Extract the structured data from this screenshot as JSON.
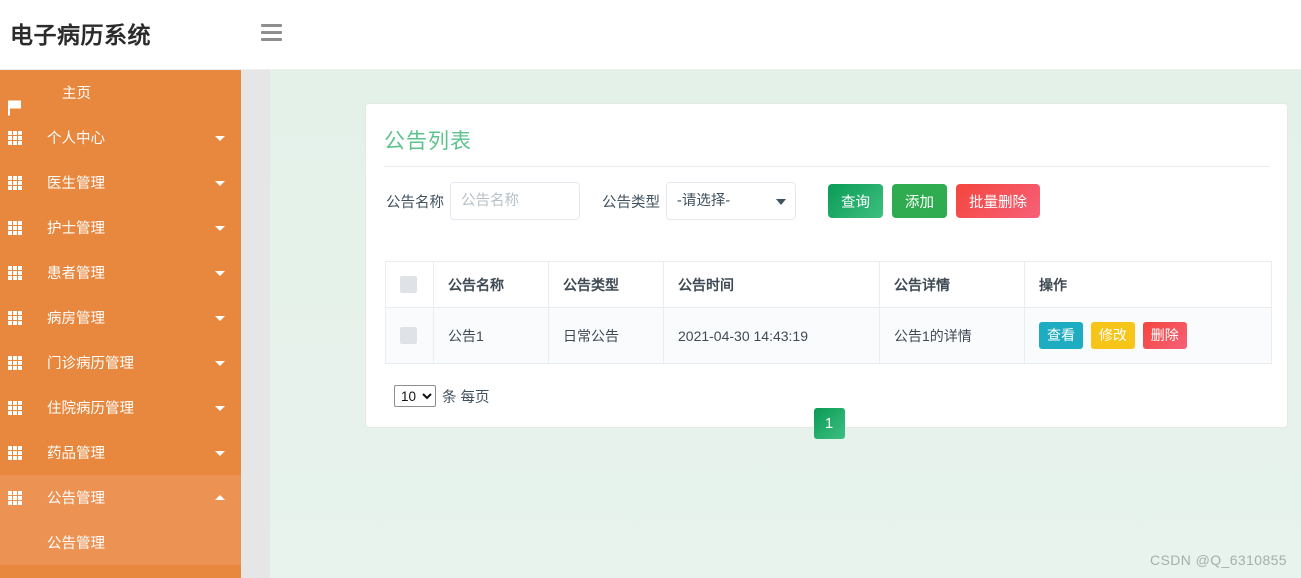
{
  "header": {
    "brand": "电子病历系统",
    "menu_toggle_icon": "hamburger-icon"
  },
  "sidebar": {
    "items": [
      {
        "label": "主页",
        "icon": "flag-icon",
        "has_caret": false,
        "expanded": false
      },
      {
        "label": "个人中心",
        "icon": "grid-icon",
        "has_caret": true,
        "expanded": false
      },
      {
        "label": "医生管理",
        "icon": "grid-icon",
        "has_caret": true,
        "expanded": false
      },
      {
        "label": "护士管理",
        "icon": "grid-icon",
        "has_caret": true,
        "expanded": false
      },
      {
        "label": "患者管理",
        "icon": "grid-icon",
        "has_caret": true,
        "expanded": false
      },
      {
        "label": "病房管理",
        "icon": "grid-icon",
        "has_caret": true,
        "expanded": false
      },
      {
        "label": "门诊病历管理",
        "icon": "grid-icon",
        "has_caret": true,
        "expanded": false
      },
      {
        "label": "住院病历管理",
        "icon": "grid-icon",
        "has_caret": true,
        "expanded": false
      },
      {
        "label": "药品管理",
        "icon": "grid-icon",
        "has_caret": true,
        "expanded": false
      },
      {
        "label": "公告管理",
        "icon": "grid-icon",
        "has_caret": true,
        "expanded": true
      }
    ],
    "submenu": [
      {
        "label": "公告管理"
      }
    ]
  },
  "main": {
    "card_title": "公告列表",
    "search": {
      "name_label": "公告名称",
      "name_placeholder": "公告名称",
      "name_value": "",
      "type_label": "公告类型",
      "type_selected": "-请选择-",
      "type_options": [
        "-请选择-"
      ]
    },
    "buttons": {
      "query": "查询",
      "add": "添加",
      "batch_delete": "批量删除"
    },
    "table": {
      "columns": [
        "",
        "公告名称",
        "公告类型",
        "公告时间",
        "公告详情",
        "操作"
      ],
      "rows": [
        {
          "name": "公告1",
          "type": "日常公告",
          "time": "2021-04-30 14:43:19",
          "detail": "公告1的详情",
          "actions": {
            "view": "查看",
            "edit": "修改",
            "delete": "删除"
          }
        }
      ]
    },
    "pagination": {
      "page_size": "10",
      "page_size_options": [
        "10"
      ],
      "per_page_text": "条 每页",
      "current_page": "1"
    }
  },
  "watermark": "CSDN @Q_6310855",
  "colors": {
    "sidebar": "#e8883f",
    "sidebar_open": "#ec9354",
    "accent_green": "#5ec28d",
    "content_bg": "#e5f2e9",
    "btn_query": "#0a9a57",
    "btn_add": "#2eac4f",
    "btn_danger": "#f4463d",
    "btn_view": "#1eacc0",
    "btn_edit": "#f7c518"
  }
}
